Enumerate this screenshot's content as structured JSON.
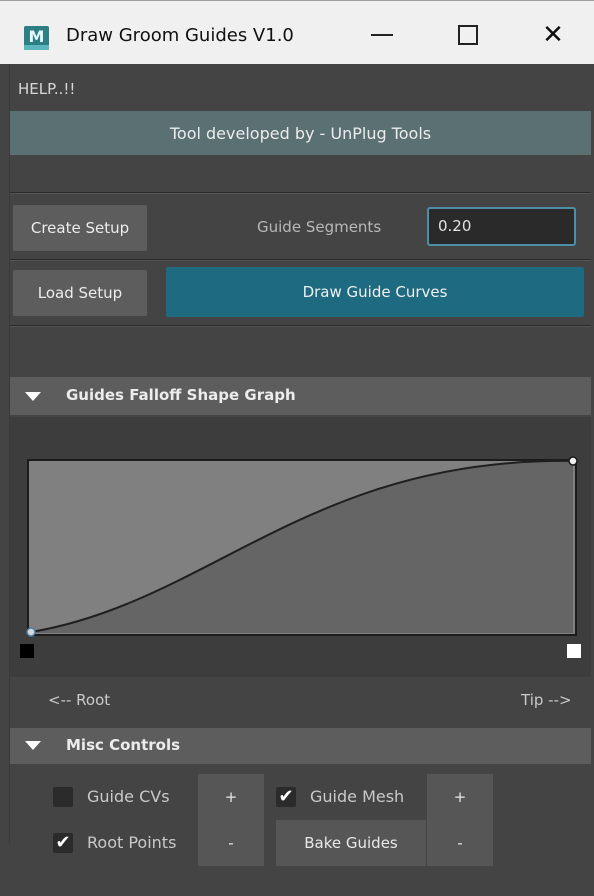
{
  "window": {
    "title": "Draw Groom Guides V1.0",
    "logo_letter": "M",
    "minimize_icon": "minimize-icon",
    "maximize_icon": "maximize-icon",
    "close_glyph": "✕"
  },
  "menu": {
    "help_label": "HELP..!!"
  },
  "banner": {
    "text": "Tool developed by - UnPlug Tools",
    "color": "#5b7072"
  },
  "setup": {
    "create_label": "Create Setup",
    "load_label": "Load Setup",
    "segments_label": "Guide Segments",
    "segments_value": "0.20",
    "draw_label": "Draw Guide Curves",
    "draw_color": "#1e6a80"
  },
  "falloff": {
    "header": "Guides Falloff Shape Graph",
    "root_label": "<-- Root",
    "tip_label": "Tip -->"
  },
  "misc": {
    "header": "Misc Controls",
    "guide_cvs": {
      "label": "Guide CVs",
      "checked": false
    },
    "guide_mesh": {
      "label": "Guide Mesh",
      "checked": true
    },
    "root_points": {
      "label": "Root Points",
      "checked": true
    },
    "plus_label": "+",
    "minus_label": "-",
    "bake_label": "Bake Guides",
    "check_glyph": "✔"
  }
}
